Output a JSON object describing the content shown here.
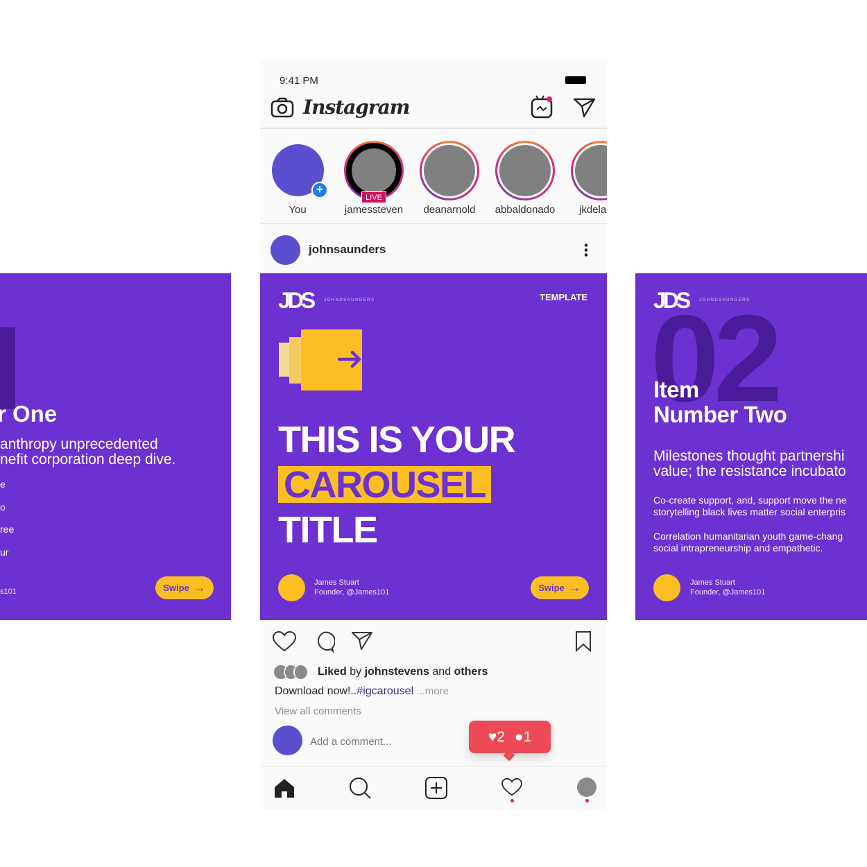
{
  "status": {
    "time": "9:41 PM"
  },
  "header": {
    "brand": "Instagram"
  },
  "stories": [
    {
      "name": "You"
    },
    {
      "name": "jamessteven",
      "badge": "LIVE"
    },
    {
      "name": "deanarnold"
    },
    {
      "name": "abbaldonado"
    },
    {
      "name": "jkdela"
    }
  ],
  "post": {
    "username": "johnsaunders",
    "liked": {
      "prefix": "Liked",
      "by": " by ",
      "user": "johnstevens",
      "and": " and ",
      "others": "others"
    },
    "caption": {
      "text": "Download now!..",
      "tag": "#igcarousel",
      "more": " ...more"
    },
    "view_comments": "View all comments",
    "comment_placeholder": "Add a comment...",
    "notif": {
      "likes": "2",
      "comments": "1"
    }
  },
  "cards": {
    "left": {
      "title": "r One",
      "para": [
        "anthropy unprecedented",
        "nefit corporation deep dive."
      ],
      "bullets": [
        "e",
        "o",
        "ree",
        "ur"
      ],
      "handle": "s101",
      "swipe": "Swipe"
    },
    "center": {
      "logo": "JDS",
      "logo_sub": "JOHNDSAUNDERS",
      "tag": "TEMPLATE",
      "title1": "THIS IS YOUR",
      "title2": "CAROUSEL",
      "title3": "TITLE",
      "author": "James Stuart",
      "role": "Founder, @James101",
      "swipe": "Swipe"
    },
    "right": {
      "logo": "JDS",
      "logo_sub": "JOHNDSAUNDERS",
      "number": "02",
      "title1": "Item",
      "title2": "Number Two",
      "para": [
        "Milestones thought partnershi",
        "value; the resistance incubato"
      ],
      "p2": [
        "Co-create support, and, support move the ne",
        "storytelling black lives matter social enterpris"
      ],
      "p3": [
        "Correlation humanitarian youth game-chang",
        "social intrapreneurship and empathetic."
      ],
      "author": "James Stuart",
      "role": "Founder, @James101"
    }
  },
  "colors": {
    "purple": "#6c31d0",
    "yellow": "#fbbf24",
    "notif": "#ed4956"
  }
}
